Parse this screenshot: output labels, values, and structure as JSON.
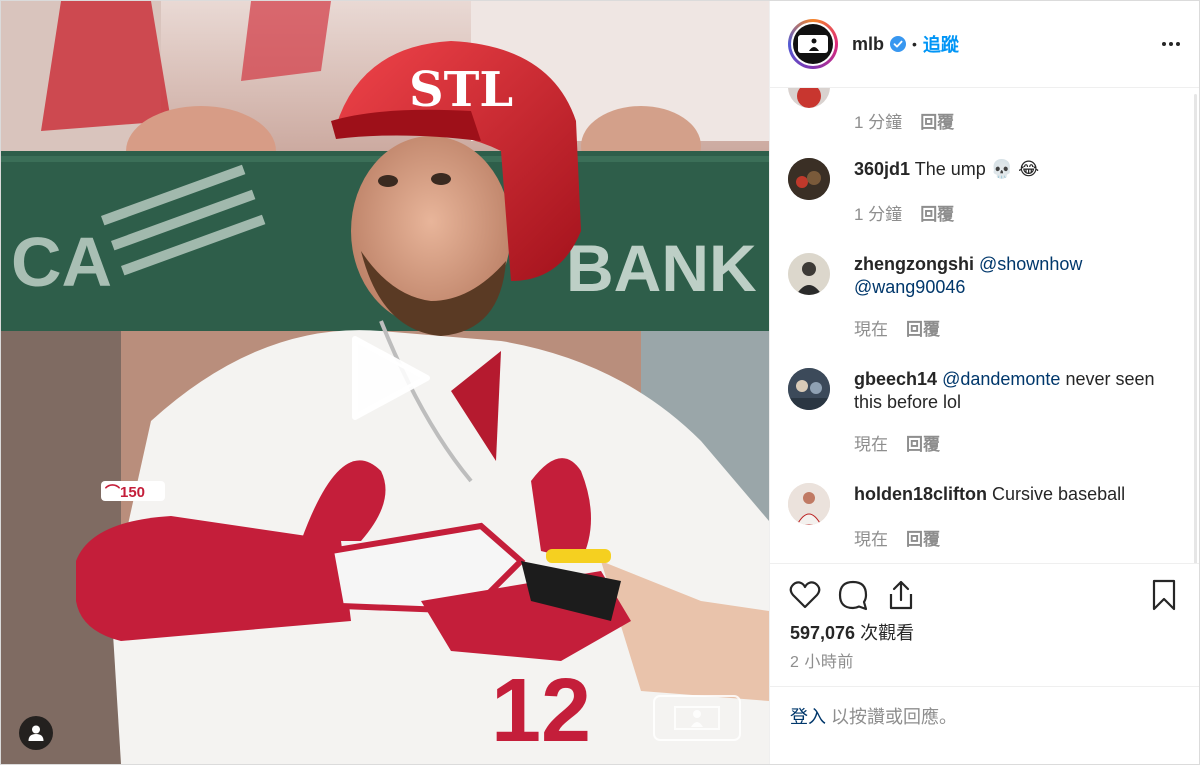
{
  "post": {
    "username": "mlb",
    "verified": true,
    "separator": "•",
    "follow_label": "追蹤",
    "more_icon": "more-options-icon"
  },
  "media": {
    "type": "video",
    "play_icon": "play-icon",
    "watermark": "MLB logo",
    "jersey_number": "12",
    "helmet_logo": "STL",
    "badge_text": "150"
  },
  "comments": [
    {
      "username": "",
      "text": "",
      "time": "1 分鐘",
      "reply": "回覆",
      "partial": true
    },
    {
      "username": "360jd1",
      "text": "The ump 💀 😂",
      "time": "1 分鐘",
      "reply": "回覆"
    },
    {
      "username": "zhengzongshi",
      "mentions": [
        "@shownhow",
        "@wang90046"
      ],
      "text": "",
      "time": "現在",
      "reply": "回覆"
    },
    {
      "username": "gbeech14",
      "mentions": [
        "@dandemonte"
      ],
      "text": "never seen this before lol",
      "time": "現在",
      "reply": "回覆"
    },
    {
      "username": "holden18clifton",
      "text": "Cursive baseball",
      "time": "現在",
      "reply": "回覆"
    }
  ],
  "actions": {
    "like_icon": "heart-icon",
    "comment_icon": "comment-icon",
    "share_icon": "share-icon",
    "save_icon": "bookmark-icon"
  },
  "stats": {
    "views_count": "597,076",
    "views_label": " 次觀看",
    "time_ago": "2 小時前"
  },
  "login": {
    "link": "登入",
    "text": " 以按讚或回應。"
  },
  "colors": {
    "accent_blue": "#0095f6",
    "mention_blue": "#00376b",
    "muted_gray": "#8e8e8e",
    "cardinals_red": "#c41e3a"
  }
}
